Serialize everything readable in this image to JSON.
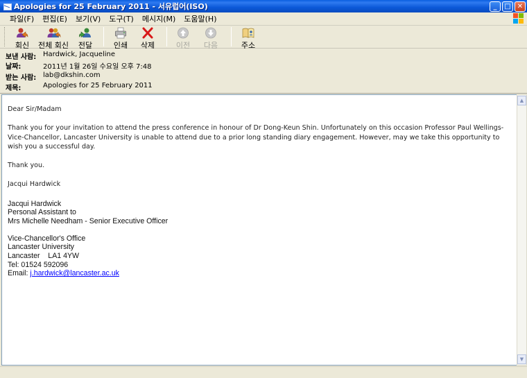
{
  "window": {
    "title": "Apologies for 25 February 2011 - 서유럽어(ISO)",
    "controls": {
      "minimize": "_",
      "maximize": "□",
      "close": "✕"
    }
  },
  "menu": {
    "items": [
      "파일(F)",
      "편집(E)",
      "보기(V)",
      "도구(T)",
      "메시지(M)",
      "도움말(H)"
    ]
  },
  "toolbar": {
    "buttons": [
      {
        "label": "회신",
        "icon": "reply-icon",
        "enabled": true
      },
      {
        "label": "전체 회신",
        "icon": "reply-all-icon",
        "enabled": true
      },
      {
        "label": "전달",
        "icon": "forward-icon",
        "enabled": true
      },
      {
        "label": "인쇄",
        "icon": "print-icon",
        "enabled": true
      },
      {
        "label": "삭제",
        "icon": "delete-icon",
        "enabled": true
      },
      {
        "label": "이전",
        "icon": "previous-icon",
        "enabled": false
      },
      {
        "label": "다음",
        "icon": "next-icon",
        "enabled": false
      },
      {
        "label": "주소",
        "icon": "address-book-icon",
        "enabled": true
      }
    ]
  },
  "header": {
    "from_label": "보낸 사람:",
    "from_value": "Hardwick, Jacqueline",
    "date_label": "날짜:",
    "date_value": "2011년 1월 26일 수요일 오후 7:48",
    "to_label": "받는 사람:",
    "to_value": "lab@dkshin.com",
    "subject_label": "제목:",
    "subject_value": "Apologies for 25 February 2011"
  },
  "message": {
    "greeting": "Dear Sir/Madam",
    "paragraph": "Thank you for your invitation to attend the press conference in honour of Dr Dong-Keun Shin.  Unfortunately on this occasion Professor Paul Wellings-Vice-Chancellor, Lancaster University is unable to attend due to a prior long standing diary engagement.  However, may we take this opportunity to wish you a successful day.",
    "thanks": "Thank you.",
    "signoff": "Jacqui Hardwick",
    "signature": {
      "name": "Jacqui Hardwick",
      "role": "Personal Assistant to",
      "boss": "Mrs Michelle Needham - Senior Executive Officer",
      "office": "Vice-Chancellor's Office",
      "university": "Lancaster University",
      "address": "Lancaster    LA1 4YW",
      "tel": "Tel: 01524 592096",
      "email_label": "Email: ",
      "email": "j.hardwick@lancaster.ac.uk"
    }
  },
  "colors": {
    "titlebar": "#0a58d8",
    "chrome": "#ece9d8",
    "link": "#0000ff"
  }
}
